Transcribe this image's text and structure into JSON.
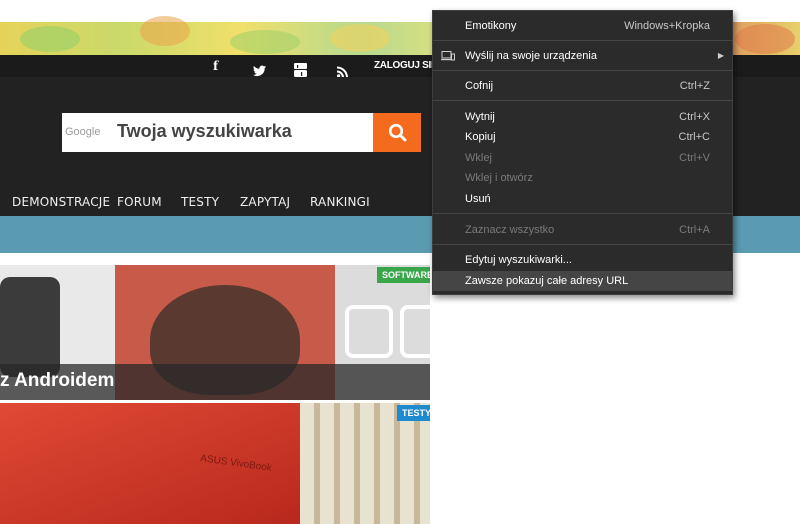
{
  "header": {
    "login_label": "ZALOGUJ SIĘ",
    "social_icons": [
      "facebook-icon",
      "twitter-icon",
      "youtube-icon",
      "rss-icon"
    ]
  },
  "search": {
    "provider": "Google",
    "text": "Twoja wyszukiwarka",
    "button_icon": "search-icon",
    "button_color": "#f56b1e"
  },
  "nav": {
    "items": [
      "DEMONSTRACJE",
      "FORUM",
      "TESTY",
      "ZAPYTAJ",
      "RANKINGI"
    ]
  },
  "cards": [
    {
      "badge": "SOFTWARE",
      "badge_color": "#3aa64a",
      "title": "z Androidem"
    },
    {
      "badge": "TESTY",
      "badge_color": "#1e8ad0",
      "image_text": "ASUS VivoBook"
    }
  ],
  "context_menu": {
    "items": [
      {
        "label": "Emotikony",
        "shortcut": "Windows+Kropka"
      },
      {
        "label": "Wyślij na swoje urządzenia",
        "shortcut": ""
      },
      {
        "label": "Cofnij",
        "shortcut": "Ctrl+Z"
      },
      {
        "label": "Wytnij",
        "shortcut": "Ctrl+X"
      },
      {
        "label": "Kopiuj",
        "shortcut": "Ctrl+C"
      },
      {
        "label": "Wklej",
        "shortcut": "Ctrl+V"
      },
      {
        "label": "Wklej i otwórz",
        "shortcut": ""
      },
      {
        "label": "Usuń",
        "shortcut": ""
      },
      {
        "label": "Zaznacz wszystko",
        "shortcut": "Ctrl+A"
      },
      {
        "label": "Edytuj wyszukiwarki...",
        "shortcut": ""
      },
      {
        "label": "Zawsze pokazuj całe adresy URL",
        "shortcut": ""
      }
    ]
  }
}
